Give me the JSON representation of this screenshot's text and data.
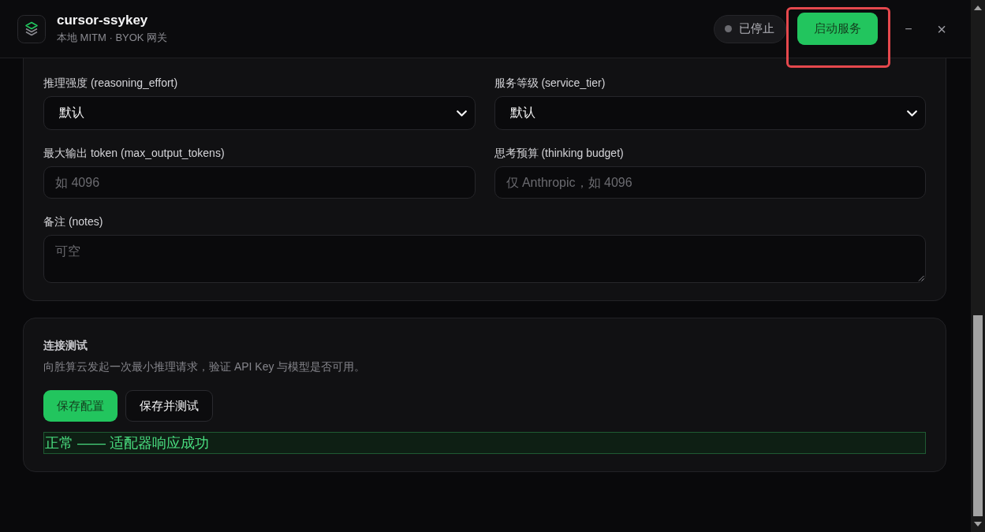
{
  "window": {
    "title": "cursor-ssykey",
    "subtitle": "本地 MITM · BYOK 网关"
  },
  "header": {
    "status": {
      "label": "已停止",
      "running": false
    },
    "start_button": {
      "label": "启动服务",
      "highlighted": true
    },
    "window_controls": [
      {
        "kind": "minimize",
        "label": "−"
      },
      {
        "kind": "close",
        "label": "×"
      }
    ]
  },
  "settings_card": {
    "fields": [
      {
        "kind": "select",
        "label": "推理强度 (reasoning_effort)",
        "value": "默认"
      },
      {
        "kind": "select",
        "label": "服务等级 (service_tier)",
        "value": "默认"
      },
      {
        "kind": "input",
        "label": "最大输出 token (max_output_tokens)",
        "placeholder": "如 4096"
      },
      {
        "kind": "input",
        "label": "思考预算 (thinking budget)",
        "placeholder": "仅 Anthropic，如 4096"
      },
      {
        "kind": "textarea",
        "label": "备注 (notes)",
        "placeholder": "可空"
      }
    ]
  },
  "test_card": {
    "title": "连接测试",
    "description": "向胜算云发起一次最小推理请求，验证 API Key 与模型是否可用。",
    "buttons": [
      {
        "kind": "primary",
        "label": "保存配置"
      },
      {
        "kind": "secondary",
        "label": "保存并测试"
      }
    ],
    "result": {
      "kind": "success",
      "text": "正常 —— 适配器响应成功"
    }
  }
}
